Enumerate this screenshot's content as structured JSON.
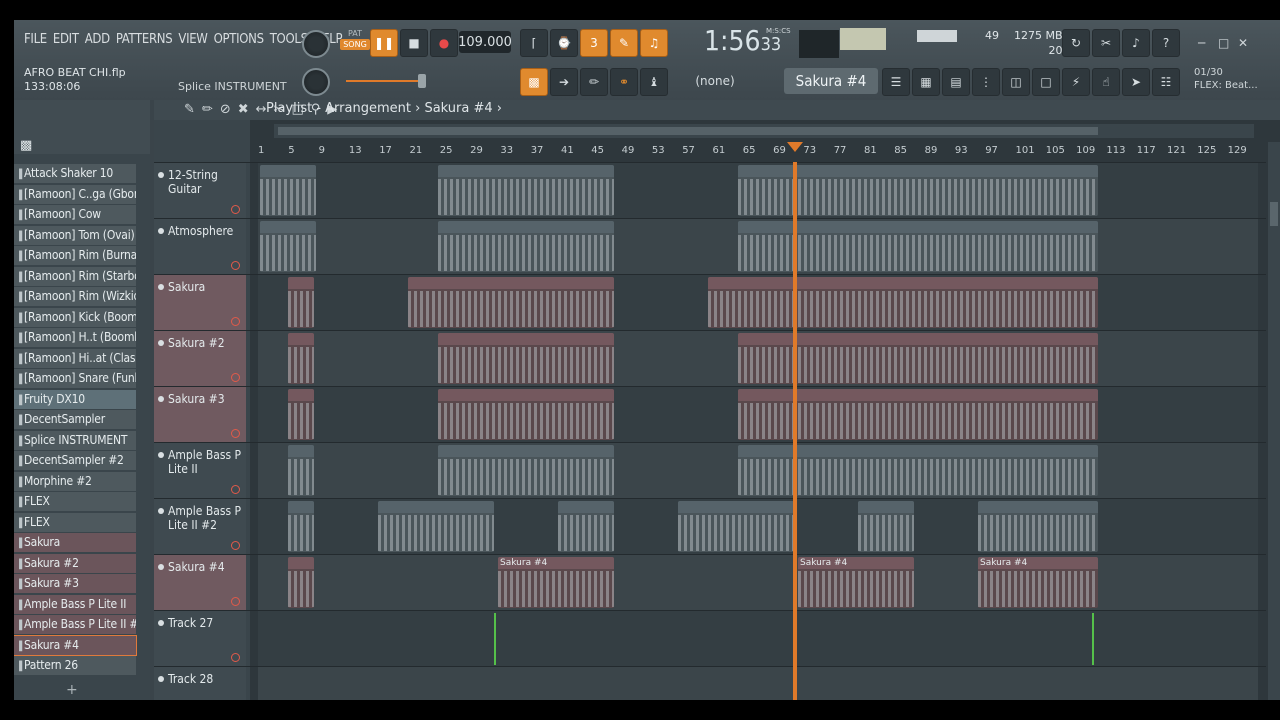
{
  "menu": [
    "FILE",
    "EDIT",
    "ADD",
    "PATTERNS",
    "VIEW",
    "OPTIONS",
    "TOOLS",
    "HELP"
  ],
  "project": {
    "file": "AFRO BEAT CHI.flp",
    "time": "133:08:06",
    "hint": "Splice INSTRUMENT"
  },
  "transport": {
    "pat_label": "PAT",
    "song_label": "SONG",
    "tempo": "109.000",
    "time_main": "1:56",
    "time_sub": "33",
    "time_unit": "M:S:CS"
  },
  "status": {
    "cpu": "49",
    "mem": "1275 MB",
    "poly": "20"
  },
  "toolbar": {
    "snap": "(none)",
    "pattern": "Sakura #4"
  },
  "flex": {
    "count": "01/30",
    "name": "FLEX: Beat..."
  },
  "channels": [
    {
      "label": "Attack Shaker 10",
      "style": ""
    },
    {
      "label": "[Ramoon] C..ga (Gbona)",
      "style": ""
    },
    {
      "label": "[Ramoon] Cow",
      "style": ""
    },
    {
      "label": "[Ramoon] Tom (Ovai)",
      "style": ""
    },
    {
      "label": "[Ramoon] Rim (Burna)",
      "style": ""
    },
    {
      "label": "[Ramoon] Rim (Starboy)",
      "style": ""
    },
    {
      "label": "[Ramoon] Rim (Wizkid)",
      "style": ""
    },
    {
      "label": "[Ramoon] Kick (Boomin)",
      "style": ""
    },
    {
      "label": "[Ramoon] H..t (Boomba)",
      "style": ""
    },
    {
      "label": "[Ramoon] Hi..at (Classic)",
      "style": ""
    },
    {
      "label": "[Ramoon] Snare (Funky)",
      "style": ""
    },
    {
      "label": "Fruity DX10",
      "style": "hl"
    },
    {
      "label": "DecentSampler",
      "style": ""
    },
    {
      "label": "Splice INSTRUMENT",
      "style": ""
    },
    {
      "label": "DecentSampler #2",
      "style": ""
    },
    {
      "label": "Morphine #2",
      "style": ""
    },
    {
      "label": "FLEX",
      "style": ""
    },
    {
      "label": "FLEX",
      "style": ""
    },
    {
      "label": "Sakura",
      "style": "pink"
    },
    {
      "label": "Sakura #2",
      "style": "pink"
    },
    {
      "label": "Sakura #3",
      "style": "pink"
    },
    {
      "label": "Ample Bass P Lite II",
      "style": "pink"
    },
    {
      "label": "Ample Bass P Lite II #2",
      "style": "pink"
    },
    {
      "label": "Sakura #4",
      "style": "sel"
    },
    {
      "label": "Pattern 26",
      "style": ""
    }
  ],
  "playlist": {
    "title": "Playlist - Arrangement",
    "pattern": "Sakura #4",
    "ruler": [
      "1",
      "5",
      "9",
      "13",
      "17",
      "21",
      "25",
      "29",
      "33",
      "37",
      "41",
      "45",
      "49",
      "53",
      "57",
      "61",
      "65",
      "69",
      "73",
      "77",
      "81",
      "85",
      "89",
      "93",
      "97",
      "101",
      "105",
      "109",
      "113",
      "117",
      "121",
      "125",
      "129"
    ],
    "tracks": [
      {
        "name": "12-String Guitar",
        "pink": false
      },
      {
        "name": "Atmosphere",
        "pink": false
      },
      {
        "name": "Sakura",
        "pink": true
      },
      {
        "name": "Sakura #2",
        "pink": true
      },
      {
        "name": "Sakura #3",
        "pink": true
      },
      {
        "name": "Ample Bass P Lite II",
        "pink": false
      },
      {
        "name": "Ample Bass P Lite II #2",
        "pink": false
      },
      {
        "name": "Sakura #4",
        "pink": true
      },
      {
        "name": "Track 27",
        "pink": false
      },
      {
        "name": "Track 28",
        "pink": false
      }
    ],
    "clip_label": "Sakura #4"
  },
  "colors": {
    "accent": "#e07a2a",
    "clip_gray": "#4a555a",
    "clip_pink": "#5a484c",
    "marker": "#55c04a"
  }
}
